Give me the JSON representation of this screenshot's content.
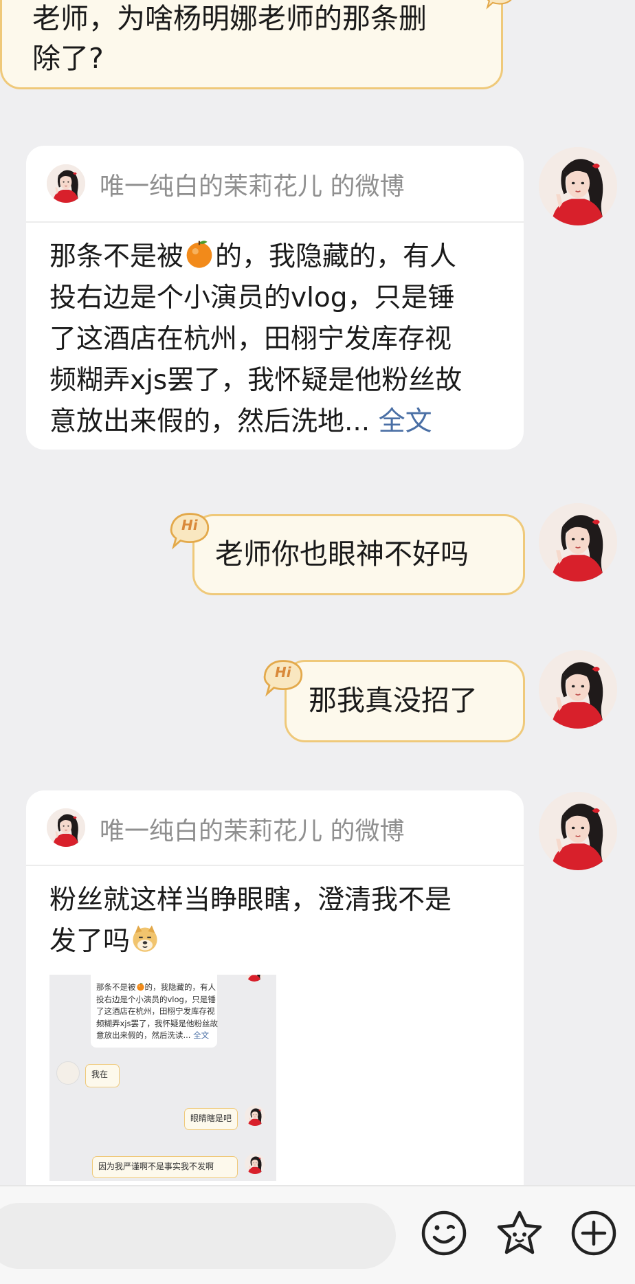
{
  "messages": {
    "m1_text_line1": "老师，为啥杨明娜老师的那条删",
    "m1_text_line2": "除了?",
    "card1": {
      "header": "唯一纯白的茉莉花儿 的微博",
      "line1_a": "那条不是被",
      "line1_b": "的，我隐藏的，有人",
      "line2": "投右边是个小演员的vlog，只是锤",
      "line3": "了这酒店在杭州，田栩宁发库存视",
      "line4": "频糊弄xjs罢了，我怀疑是他粉丝故",
      "line5": "意放出来假的，然后洗地...",
      "more_link": "全文"
    },
    "m2_text": "老师你也眼神不好吗",
    "m3_text": "那我真没招了",
    "card2": {
      "header": "唯一纯白的茉莉花儿 的微博",
      "line1": "粉丝就这样当睁眼瞎，澄清我不是",
      "line2": "发了吗",
      "screenshot": {
        "l1_a": "那条不是被",
        "l1_b": "的，我隐藏的，有人",
        "l2": "投右边是个小演员的vlog，只是锤",
        "l3": "了这酒店在杭州，田栩宁发库存视",
        "l4": "频糊弄xjs罢了，我怀疑是他粉丝故",
        "l5": "意放出来假的，然后洗读...",
        "l5_link": "全文",
        "reply1": "我在",
        "reply2": "眼睛瞎是吧",
        "reply3": "因为我严谨啊不是事实我不发啊"
      }
    }
  },
  "badge_text": "Hi",
  "icons": {
    "emoji_button": "smiley-face-icon",
    "sticker_button": "star-face-icon",
    "more_button": "plus-circle-icon"
  },
  "colors": {
    "bubble_fill": "#fdf9ec",
    "bubble_border": "#efc97a",
    "link": "#4a6fa5",
    "background": "#efeff1"
  }
}
